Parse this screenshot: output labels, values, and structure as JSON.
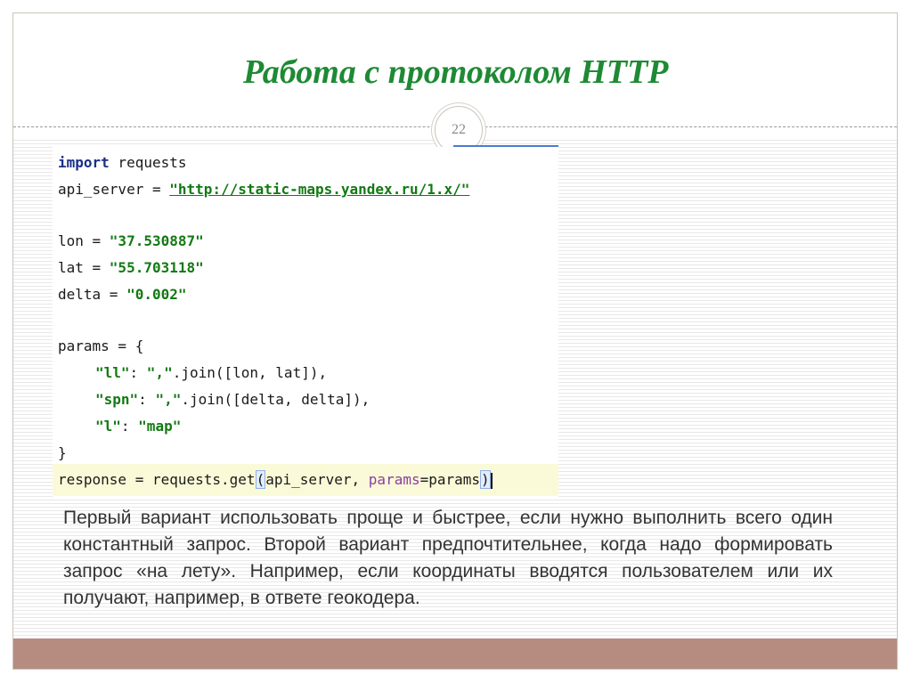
{
  "slide": {
    "title": "Работа с протоколом HTTP",
    "page_number": "22",
    "colors": {
      "title": "#1e8a34",
      "footer": "#b78c80",
      "keyword": "#1a2f8a",
      "string": "#127a12",
      "param": "#8a3fa0"
    }
  },
  "code": {
    "kw_import": "import",
    "l1_rest": " requests",
    "l2_pre": "api_server = ",
    "l2_str": "\"http://static-maps.yandex.ru/1.x/\"",
    "l3_pre": "lon = ",
    "l3_str": "\"37.530887\"",
    "l4_pre": "lat = ",
    "l4_str": "\"55.703118\"",
    "l5_pre": "delta = ",
    "l5_str": "\"0.002\"",
    "l6": "params = {",
    "l7_key": "\"ll\"",
    "l7_mid": ": ",
    "l7_sep": "\",\"",
    "l7_rest": ".join([lon, lat]),",
    "l8_key": "\"spn\"",
    "l8_mid": ": ",
    "l8_sep": "\",\"",
    "l8_rest": ".join([delta, delta]),",
    "l9_key": "\"l\"",
    "l9_mid": ": ",
    "l9_val": "\"map\"",
    "l10": "}",
    "l11_pre": "response = requests.get",
    "l11_open": "(",
    "l11_mid": "api_server, ",
    "l11_param": "params",
    "l11_eq": "=params",
    "l11_close": ")"
  },
  "description": "Первый вариант использовать проще и быстрее, если нужно выполнить всего один константный запрос. Второй вариант предпочтительнее, когда надо формировать запрос «на лету». Например, если координаты вводятся пользователем или их получают, например, в ответе геокодера."
}
